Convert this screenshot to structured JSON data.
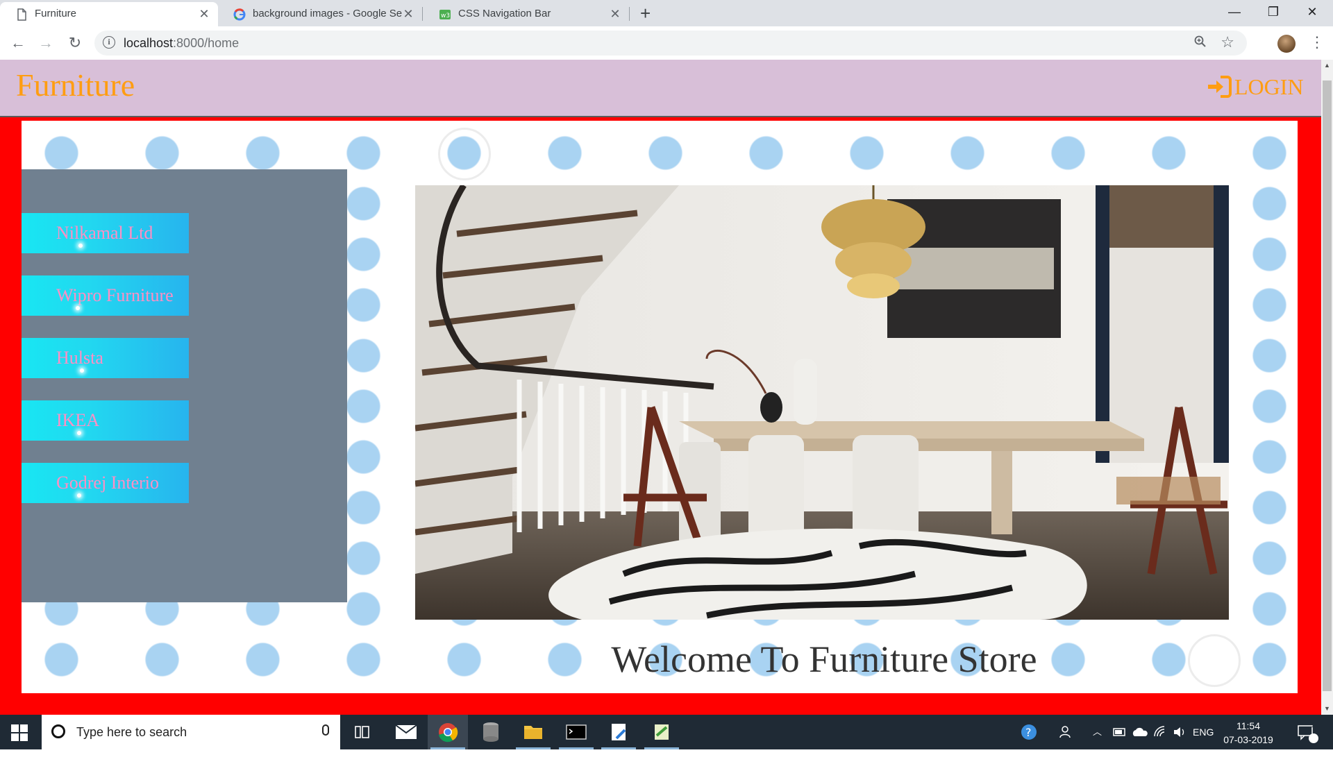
{
  "browser": {
    "tabs": [
      {
        "title": "Furniture",
        "active": true
      },
      {
        "title": "background images - Google Se",
        "active": false
      },
      {
        "title": "CSS Navigation Bar",
        "active": false
      }
    ],
    "url_host": "localhost",
    "url_path": ":8000/home",
    "window_controls": {
      "minimize": "—",
      "maximize": "❐",
      "close": "✕"
    }
  },
  "site": {
    "brand": "Furniture",
    "login_label": "LOGIN",
    "sidebar_items": [
      {
        "label": "Nilkamal Ltd"
      },
      {
        "label": "Wipro Furniture"
      },
      {
        "label": "Hulsta"
      },
      {
        "label": "IKEA"
      },
      {
        "label": "Godrej Interio"
      }
    ],
    "welcome": "Welcome To Furniture Store"
  },
  "taskbar": {
    "search_placeholder": "Type here to search",
    "language": "ENG",
    "time": "11:54",
    "date": "07-03-2019",
    "notification_count": "1"
  },
  "colors": {
    "header_bg": "#d8bfd8",
    "brand": "#ff9d12",
    "frame": "#ff0000",
    "sidebar_bg": "#708090",
    "menu_text": "#ff8fc4"
  }
}
